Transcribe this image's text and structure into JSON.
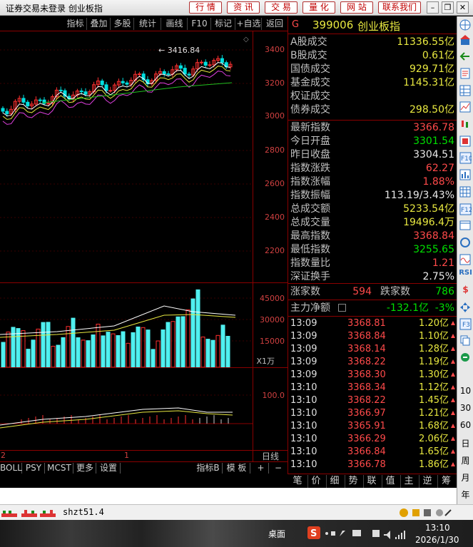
{
  "window": {
    "title": "证券交易未登录  创业板指",
    "top_buttons": [
      "行 情",
      "资 讯",
      "交 易",
      "量 化",
      "网 站",
      "联系我们"
    ],
    "win_buttons": [
      "–",
      "❐",
      "✕"
    ]
  },
  "chart_toolbar": {
    "items": [
      "指标",
      "叠加",
      "多股",
      "统计",
      "画线",
      "F10",
      "标记",
      "+自选",
      "返回"
    ]
  },
  "chart": {
    "price_axis": [
      "3400",
      "3200",
      "3000",
      "2800",
      "2600",
      "2400",
      "2200"
    ],
    "high_label": "3416.84",
    "volume_axis": [
      "45000",
      "30000",
      "15000"
    ],
    "volume_unit": "X1万",
    "indicator_axis": [
      "100.0"
    ],
    "time_labels": [
      "2",
      "1"
    ],
    "period": "日线"
  },
  "bottom_tabs": [
    "BOLL",
    "PSY",
    "MCST",
    "更多",
    "设置",
    "指标B",
    "模 板",
    "+",
    "−"
  ],
  "quote": {
    "flag": "G",
    "code": "399006",
    "name": "创业板指",
    "market": [
      {
        "label": "A股成交",
        "value": "11336.55亿"
      },
      {
        "label": "B股成交",
        "value": "0.61亿"
      },
      {
        "label": "国债成交",
        "value": "929.71亿"
      },
      {
        "label": "基金成交",
        "value": "1145.31亿"
      },
      {
        "label": "权证成交",
        "value": ""
      },
      {
        "label": "债券成交",
        "value": "298.50亿"
      }
    ],
    "stats": [
      {
        "label": "最新指数",
        "value": "3366.78",
        "color": "red"
      },
      {
        "label": "今日开盘",
        "value": "3301.54",
        "color": "green"
      },
      {
        "label": "昨日收盘",
        "value": "3304.51",
        "color": "white"
      },
      {
        "label": "指数涨跌",
        "value": "62.27",
        "color": "red"
      },
      {
        "label": "指数涨幅",
        "value": "1.88%",
        "color": "red"
      },
      {
        "label": "指数振幅",
        "value": "113.19/3.43%",
        "color": "white"
      },
      {
        "label": "总成交额",
        "value": "5233.54亿",
        "color": "yellow"
      },
      {
        "label": "总成交量",
        "value": "19496.4万",
        "color": "yellow"
      },
      {
        "label": "最高指数",
        "value": "3368.84",
        "color": "red"
      },
      {
        "label": "最低指数",
        "value": "3255.65",
        "color": "green"
      },
      {
        "label": "指数量比",
        "value": "1.21",
        "color": "red"
      },
      {
        "label": "深证换手",
        "value": "2.75%",
        "color": "white"
      }
    ],
    "breadth": {
      "up_label": "涨家数",
      "up_value": "594",
      "down_label": "跌家数",
      "down_value": "786"
    },
    "net_flow": {
      "label": "主力净额",
      "value": "-132.1亿",
      "pct": "-3%"
    },
    "ticks": [
      {
        "time": "13:09",
        "price": "3368.81",
        "vol": "1.20亿"
      },
      {
        "time": "13:09",
        "price": "3368.84",
        "vol": "1.10亿"
      },
      {
        "time": "13:09",
        "price": "3368.14",
        "vol": "1.28亿"
      },
      {
        "time": "13:09",
        "price": "3368.22",
        "vol": "1.19亿"
      },
      {
        "time": "13:09",
        "price": "3368.30",
        "vol": "1.30亿"
      },
      {
        "time": "13:10",
        "price": "3368.34",
        "vol": "1.12亿"
      },
      {
        "time": "13:10",
        "price": "3368.22",
        "vol": "1.45亿"
      },
      {
        "time": "13:10",
        "price": "3366.97",
        "vol": "1.21亿"
      },
      {
        "time": "13:10",
        "price": "3365.91",
        "vol": "1.68亿"
      },
      {
        "time": "13:10",
        "price": "3366.29",
        "vol": "2.06亿"
      },
      {
        "time": "13:10",
        "price": "3366.84",
        "vol": "1.65亿"
      },
      {
        "time": "13:10",
        "price": "3366.78",
        "vol": "1.86亿"
      }
    ]
  },
  "right_tabs": [
    "笔",
    "价",
    "细",
    "势",
    "联",
    "值",
    "主",
    "逆",
    "筹"
  ],
  "sidebar_text": [
    "10",
    "30",
    "60",
    "日",
    "周",
    "月",
    "年"
  ],
  "status": {
    "connection": "shzt51.4"
  },
  "taskbar": {
    "desktop": "桌面",
    "time": "13:10",
    "date": "2026/1/30"
  }
}
